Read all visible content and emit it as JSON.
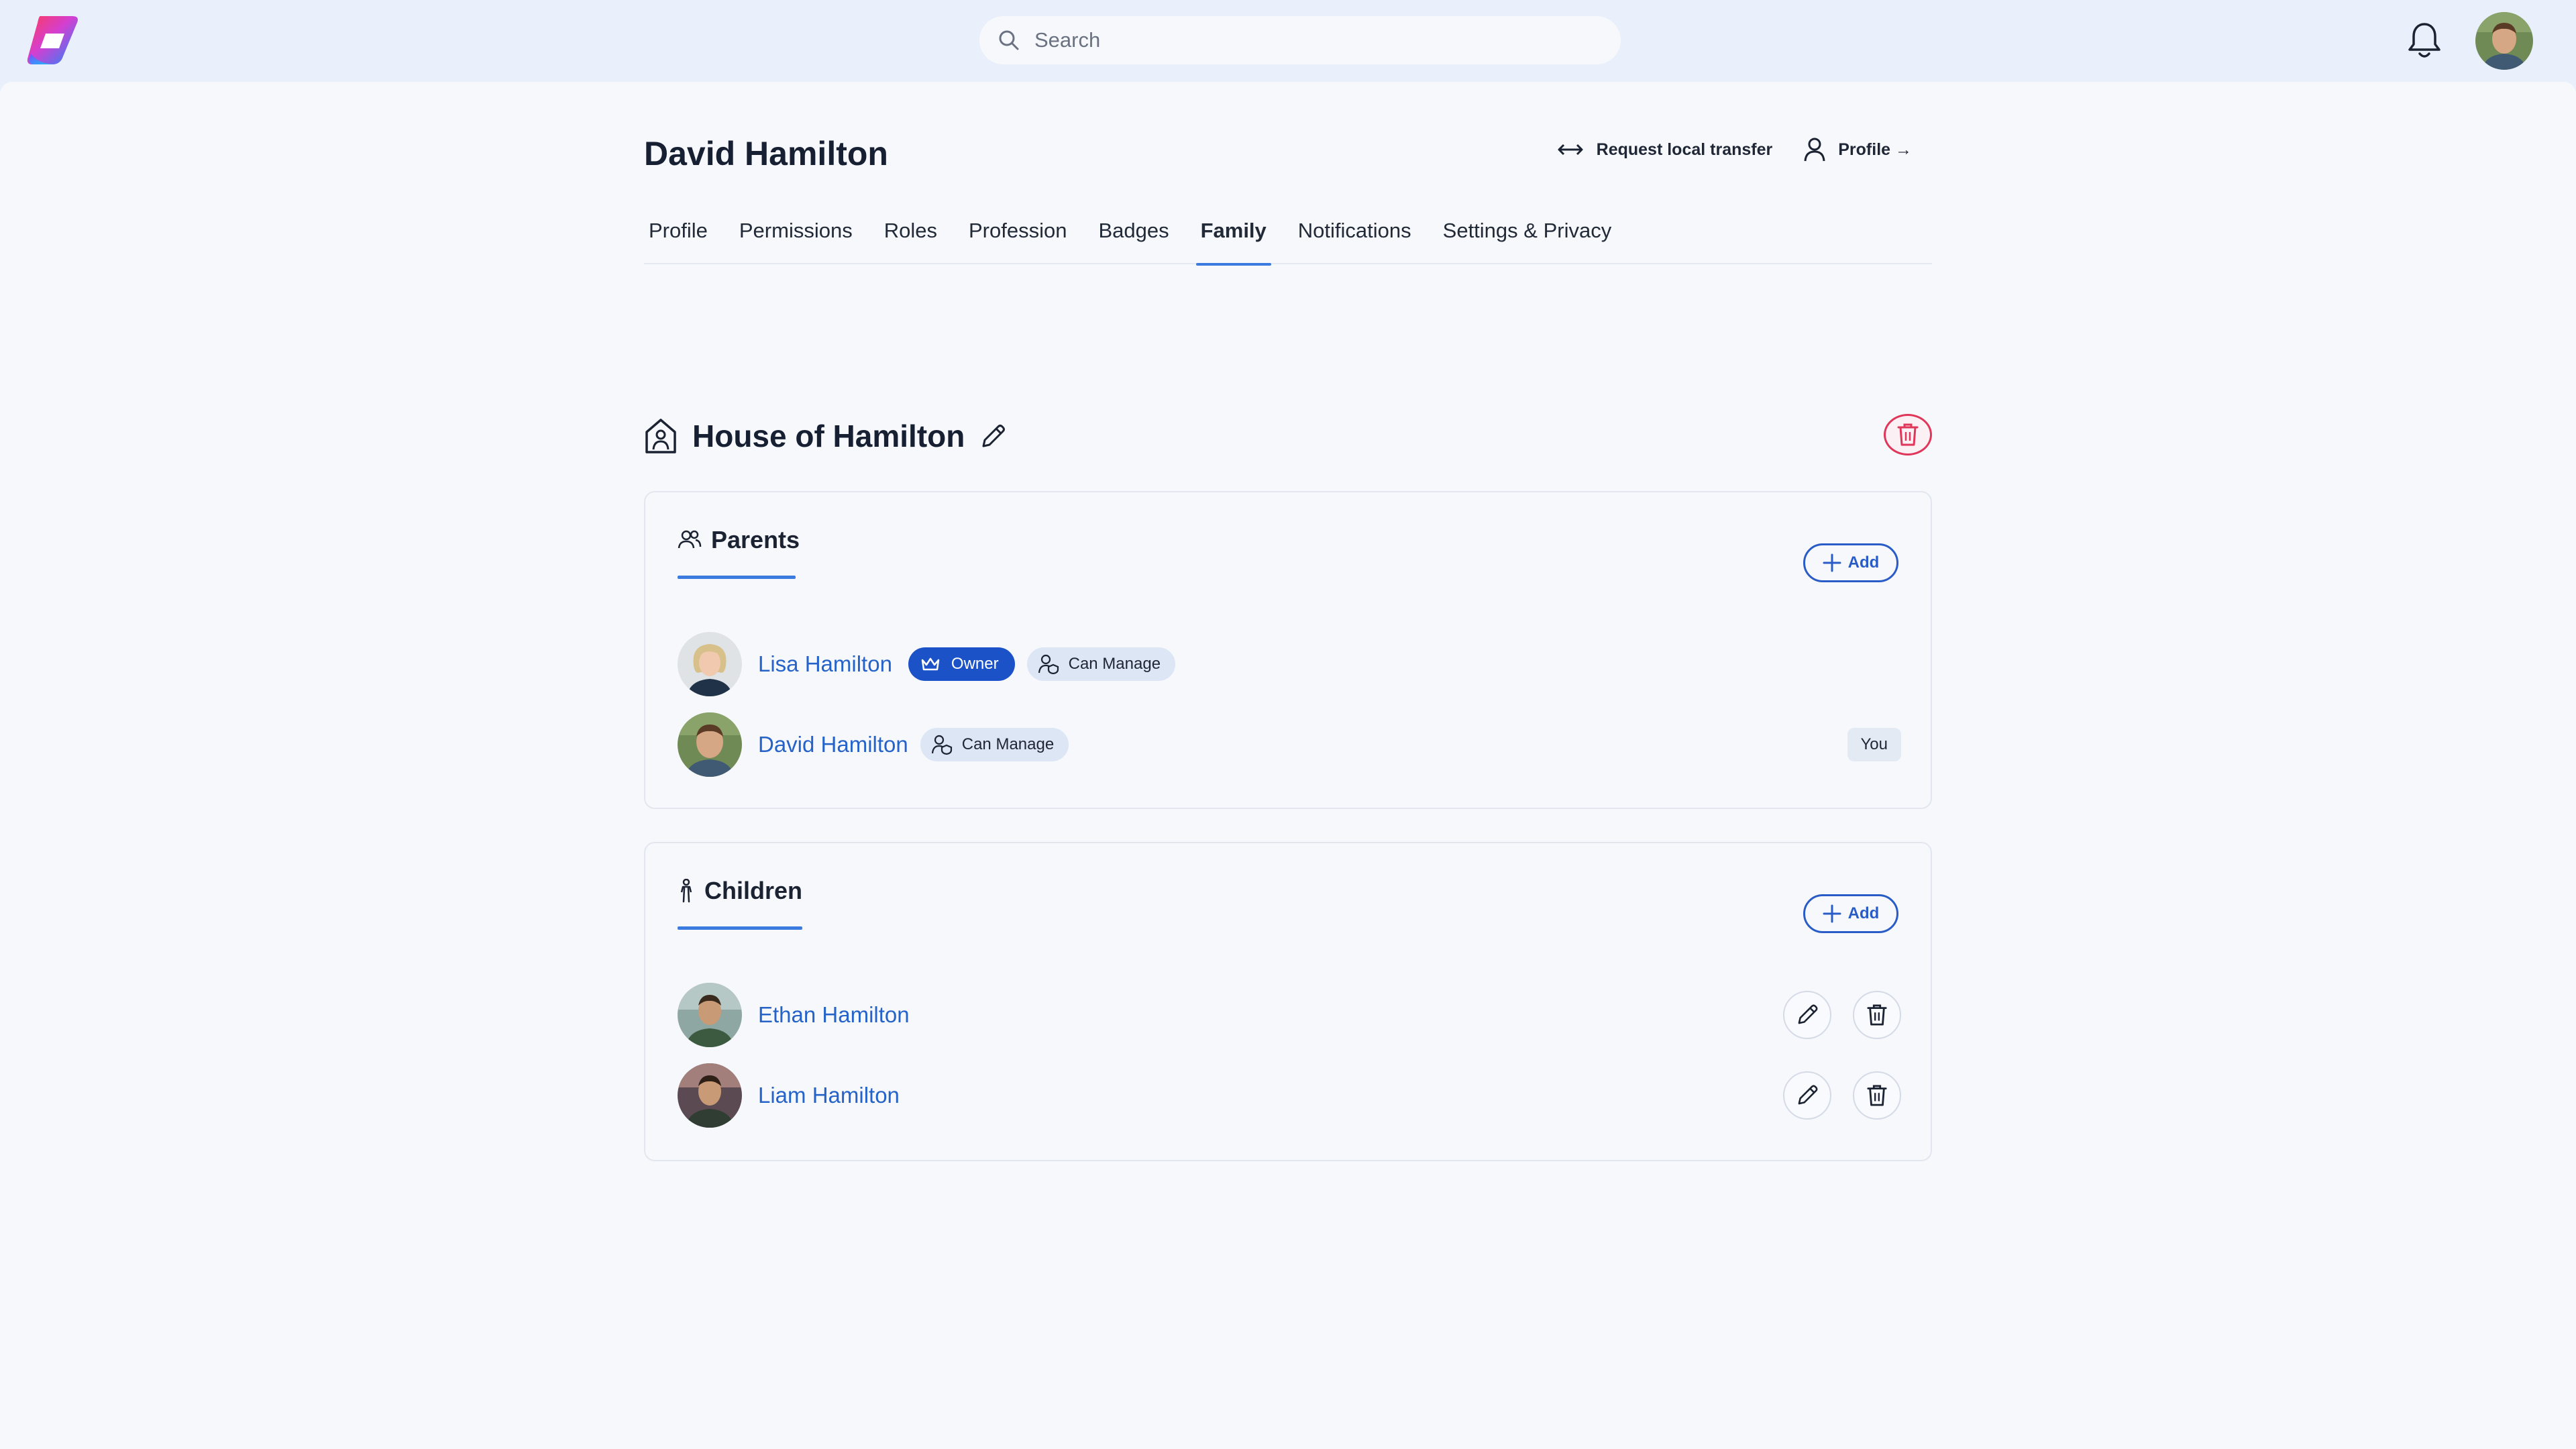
{
  "app": {
    "logo": "app-logo",
    "search": {
      "placeholder": "Search",
      "value": ""
    }
  },
  "header": {
    "title": "David Hamilton",
    "actions": [
      {
        "label": "Request local transfer",
        "icon": "arrows-left-right-icon"
      },
      {
        "label": "Profile →",
        "icon": "user-icon"
      }
    ]
  },
  "tabs": [
    {
      "label": "Profile",
      "active": false
    },
    {
      "label": "Permissions",
      "active": false
    },
    {
      "label": "Roles",
      "active": false
    },
    {
      "label": "Profession",
      "active": false
    },
    {
      "label": "Badges",
      "active": false
    },
    {
      "label": "Family",
      "active": true
    },
    {
      "label": "Notifications",
      "active": false
    },
    {
      "label": "Settings & Privacy",
      "active": false
    }
  ],
  "household": {
    "title": "House of Hamilton",
    "icon": "home-person-icon"
  },
  "parents": {
    "label": "Parents",
    "add_label": "Add",
    "members": [
      {
        "name": "Lisa Hamilton",
        "owner_badge": "Owner",
        "manage_badge": "Can Manage"
      },
      {
        "name": "David Hamilton",
        "manage_badge": "Can Manage",
        "you_badge": "You"
      }
    ]
  },
  "children": {
    "label": "Children",
    "add_label": "Add",
    "members": [
      {
        "name": "Ethan Hamilton"
      },
      {
        "name": "Liam Hamilton"
      }
    ]
  },
  "colors": {
    "accent": "#2563c9",
    "owner_badge": "#1b52c8",
    "danger": "#e0365a",
    "background": "#f6f8fc",
    "topbar": "#e9f0fb"
  }
}
